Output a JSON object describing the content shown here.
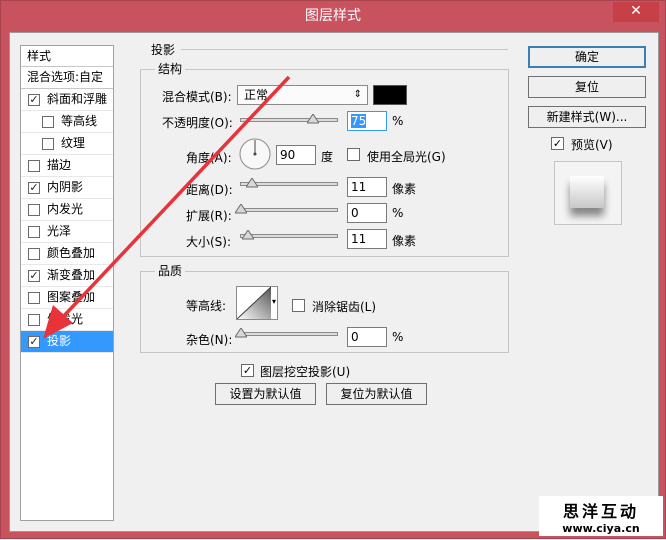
{
  "window": {
    "title": "图层样式",
    "close_symbol": "✕"
  },
  "style_list": {
    "header": "样式",
    "blend_options": "混合选项:自定",
    "items": [
      {
        "label": "斜面和浮雕",
        "checked": true
      },
      {
        "label": "等高线",
        "checked": false
      },
      {
        "label": "纹理",
        "checked": false
      },
      {
        "label": "描边",
        "checked": false
      },
      {
        "label": "内阴影",
        "checked": true
      },
      {
        "label": "内发光",
        "checked": false
      },
      {
        "label": "光泽",
        "checked": false
      },
      {
        "label": "颜色叠加",
        "checked": false
      },
      {
        "label": "渐变叠加",
        "checked": true
      },
      {
        "label": "图案叠加",
        "checked": false
      },
      {
        "label": "外发光",
        "checked": false
      },
      {
        "label": "投影",
        "checked": true,
        "selected": true
      }
    ]
  },
  "drop_shadow": {
    "section_title": "投影",
    "structure": {
      "group_title": "结构",
      "blend_mode_label": "混合模式(B):",
      "blend_mode_value": "正常",
      "blend_mode_arrow": "⇕",
      "shadow_color": "#000000",
      "opacity_label": "不透明度(O):",
      "opacity_value": "75",
      "percent": "%",
      "angle_label": "角度(A):",
      "angle_value": "90",
      "degree_unit": "度",
      "global_light_label": "使用全局光(G)",
      "global_light_checked": false,
      "distance_label": "距离(D):",
      "distance_value": "11",
      "pixels_unit": "像素",
      "spread_label": "扩展(R):",
      "spread_value": "0",
      "size_label": "大小(S):",
      "size_value": "11"
    },
    "quality": {
      "group_title": "品质",
      "contour_label": "等高线:",
      "anti_alias_label": "消除锯齿(L)",
      "anti_alias_checked": false,
      "noise_label": "杂色(N):",
      "noise_value": "0"
    },
    "knockout_label": "图层挖空投影(U)",
    "knockout_checked": true,
    "make_default_label": "设置为默认值",
    "reset_default_label": "复位为默认值"
  },
  "buttons": {
    "ok": "确定",
    "reset": "复位",
    "new_style": "新建样式(W)...",
    "preview_label": "预览(V)",
    "preview_checked": true
  },
  "watermark": {
    "line1": "思洋互动",
    "line2": "www.ciya.cn"
  },
  "colors": {
    "title_bar": "#c8525e",
    "selection": "#3399ff",
    "arrow": "#e8333a"
  }
}
